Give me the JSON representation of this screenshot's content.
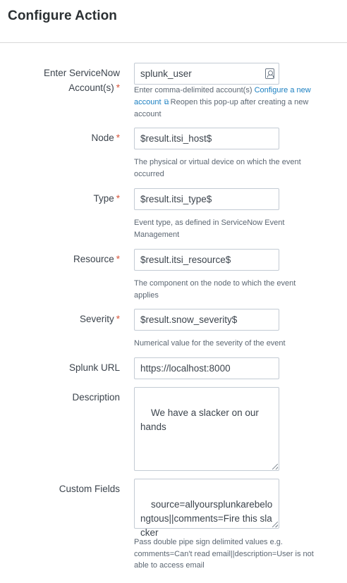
{
  "header": {
    "title": "Configure Action"
  },
  "fields": {
    "account": {
      "label": "Enter ServiceNow Account(s)",
      "value": "splunk_user",
      "help_prefix": "Enter comma-delimited account(s) ",
      "configure_link": "Configure a new account",
      "help_suffix": "Reopen this pop-up after creating a new account"
    },
    "node": {
      "label": "Node",
      "value": "$result.itsi_host$",
      "help": "The physical or virtual device on which the event occurred"
    },
    "type": {
      "label": "Type",
      "value": "$result.itsi_type$",
      "help": "Event type, as defined in ServiceNow Event Management"
    },
    "resource": {
      "label": "Resource",
      "value": "$result.itsi_resource$",
      "help": "The component on the node to which the event applies"
    },
    "severity": {
      "label": "Severity",
      "value": "$result.snow_severity$",
      "help": "Numerical value for the severity of the event"
    },
    "splunk_url": {
      "label": "Splunk URL",
      "value": "https://localhost:8000"
    },
    "description": {
      "label": "Description",
      "value": "We have a slacker on our hands"
    },
    "custom_fields": {
      "label": "Custom Fields",
      "value": "source=allyoursplunkarebelongtous||comments=Fire this slacker",
      "help": "Pass double pipe sign delimited values e.g. comments=Can't read email||description=User is not able to access email"
    }
  },
  "required_marker": "*"
}
